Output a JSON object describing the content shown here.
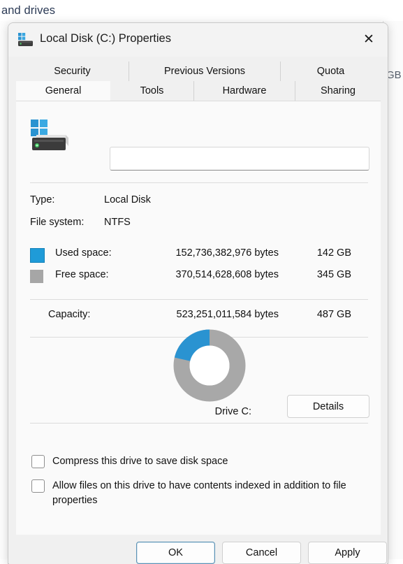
{
  "background": {
    "heading": "and drives",
    "right_label": "GB"
  },
  "dialog": {
    "title": "Local Disk (C:) Properties",
    "title_icon": "hard-drive-windows-icon",
    "close_icon": "✕"
  },
  "tabs": {
    "top_row": [
      {
        "label": "Security",
        "selected": false
      },
      {
        "label": "Previous Versions",
        "selected": false
      },
      {
        "label": "Quota",
        "selected": false
      }
    ],
    "bottom_row": [
      {
        "label": "General",
        "selected": true
      },
      {
        "label": "Tools",
        "selected": false
      },
      {
        "label": "Hardware",
        "selected": false
      },
      {
        "label": "Sharing",
        "selected": false
      }
    ]
  },
  "general": {
    "volume_name_value": "",
    "volume_name_placeholder": "",
    "type_label": "Type:",
    "type_value": "Local Disk",
    "filesystem_label": "File system:",
    "filesystem_value": "NTFS",
    "used_label": "Used space:",
    "used_bytes": "152,736,382,976 bytes",
    "used_gb": "142 GB",
    "free_label": "Free space:",
    "free_bytes": "370,514,628,608 bytes",
    "free_gb": "345 GB",
    "capacity_label": "Capacity:",
    "capacity_bytes": "523,251,011,584 bytes",
    "capacity_gb": "487 GB",
    "drive_letter_label": "Drive C:",
    "details_label": "Details",
    "compress_label": "Compress this drive to save disk space",
    "index_label": "Allow files on this drive to have contents indexed in addition to file properties",
    "compress_checked": false,
    "index_checked": false
  },
  "colors": {
    "used": "#2a93d1",
    "free": "#a8a8a8",
    "accent": "#5a91b4"
  },
  "chart_data": {
    "type": "pie",
    "title": "Drive C:",
    "labels": [
      "Used space",
      "Free space"
    ],
    "values": [
      152736382976,
      370514628608
    ],
    "value_labels": [
      "142 GB",
      "345 GB"
    ],
    "percentages": [
      29.2,
      70.8
    ],
    "colors": [
      "#2a93d1",
      "#a8a8a8"
    ],
    "donut": true,
    "inner_radius_ratio": 0.55,
    "legend": "left-list",
    "total": 523251011584,
    "total_label": "487 GB"
  },
  "footer": {
    "ok_label": "OK",
    "cancel_label": "Cancel",
    "apply_label": "Apply"
  }
}
